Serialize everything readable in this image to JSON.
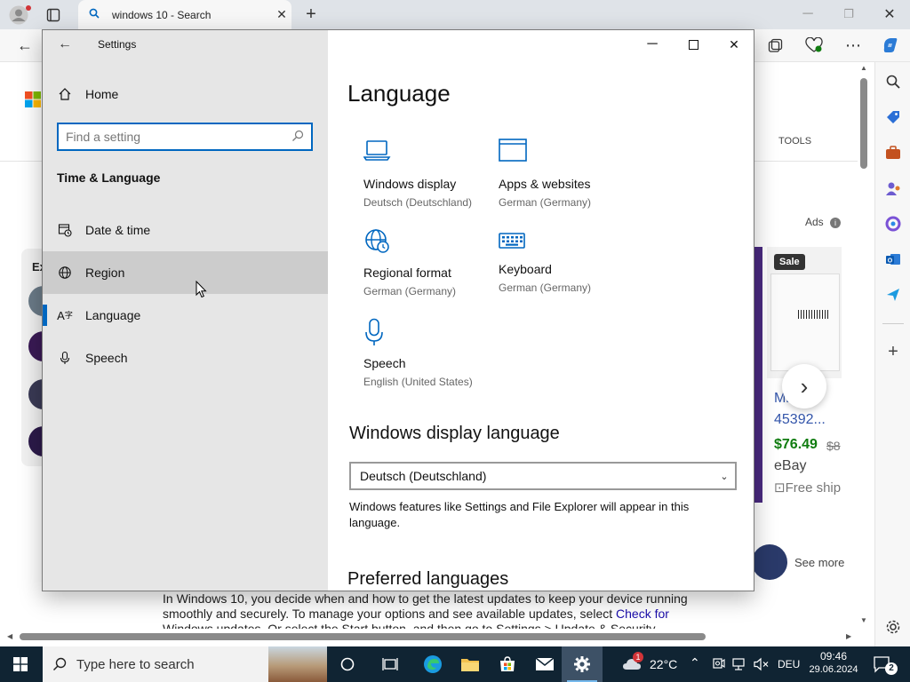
{
  "browser": {
    "tab_title": "windows 10 - Search",
    "page_tools_label": "TOOLS",
    "ads_label": "Ads",
    "shopping": {
      "sale_badge": "Sale",
      "title_line1": "Mi      oft",
      "title_line2": "45392...",
      "price": "$76.49",
      "old_price": "$8",
      "store": "eBay",
      "shipping": "Free ship"
    },
    "left_card_label": "Ex",
    "see_more": "See more",
    "article_line1": "In Windows 10, you decide when and how to get the latest updates to keep your device running",
    "article_line2_a": "smoothly and securely. To manage your options and see available updates, select ",
    "article_line2_link": "Check for",
    "article_line3": "Windows updates. Or select the Start button, and then go to Settings > Update & Security"
  },
  "settings": {
    "window_title": "Settings",
    "nav_home": "Home",
    "search_placeholder": "Find a setting",
    "section_title": "Time & Language",
    "nav_items": [
      {
        "label": "Date & time"
      },
      {
        "label": "Region"
      },
      {
        "label": "Language"
      },
      {
        "label": "Speech"
      }
    ],
    "page_title": "Language",
    "tiles": [
      {
        "label": "Windows display",
        "sub": "Deutsch (Deutschland)"
      },
      {
        "label": "Apps & websites",
        "sub": "German (Germany)"
      },
      {
        "label": "Regional format",
        "sub": "German (Germany)"
      },
      {
        "label": "Keyboard",
        "sub": "German (Germany)"
      },
      {
        "label": "Speech",
        "sub": "English (United States)"
      }
    ],
    "display_language_heading": "Windows display language",
    "display_language_value": "Deutsch (Deutschland)",
    "display_language_desc": "Windows features like Settings and File Explorer will appear in this language.",
    "preferred_heading": "Preferred languages"
  },
  "taskbar": {
    "search_placeholder": "Type here to search",
    "temperature": "22°C",
    "language": "DEU",
    "time": "09:46",
    "date": "29.06.2024",
    "notification_count": "2",
    "weather_badge": "1"
  },
  "colors": {
    "accent": "#0067c0",
    "taskbar": "#102433",
    "nav_bg": "#e6e6e6",
    "price_green": "#107c10"
  }
}
